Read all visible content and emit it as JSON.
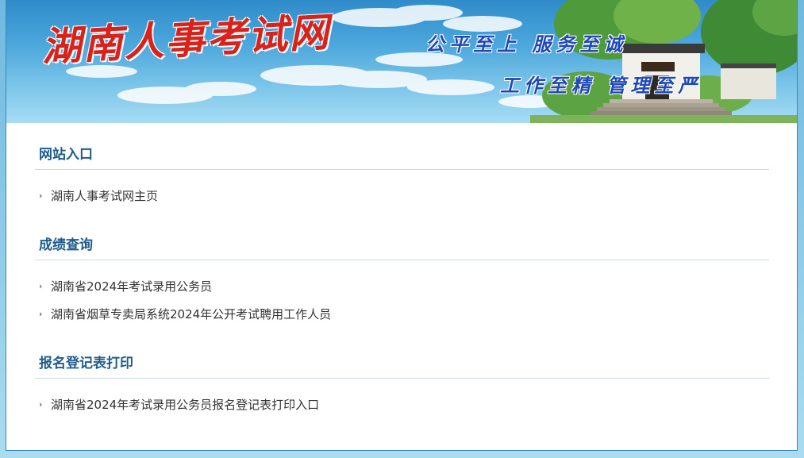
{
  "header": {
    "logo_text": "湖南人事考试网",
    "slogan_line1": "公平至上 服务至诚",
    "slogan_line2": "工作至精 管理至严"
  },
  "sections": [
    {
      "title": "网站入口",
      "links": [
        "湖南人事考试网主页"
      ]
    },
    {
      "title": "成绩查询",
      "links": [
        "湖南省2024年考试录用公务员",
        "湖南省烟草专卖局系统2024年公开考试聘用工作人员"
      ]
    },
    {
      "title": "报名登记表打印",
      "links": [
        "湖南省2024年考试录用公务员报名登记表打印入口"
      ]
    }
  ],
  "colors": {
    "section_title": "#1f5c8c",
    "link_text": "#333333",
    "logo": "#d8231c",
    "slogan": "#1e49b6",
    "frame_border": "#3d86b8"
  }
}
